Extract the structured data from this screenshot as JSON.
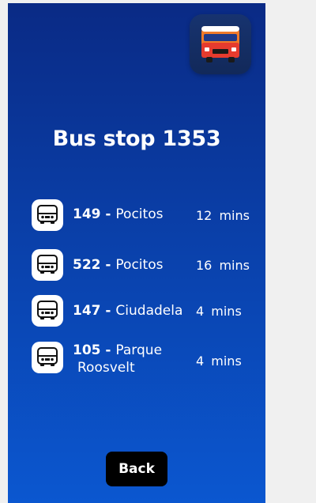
{
  "app_icon": "bus-app-icon",
  "title": "Bus stop 1353",
  "arrivals": [
    {
      "icon": "bus-icon",
      "route": "149",
      "separator": " - ",
      "destination": "Pocitos",
      "eta": "12 mins"
    },
    {
      "icon": "bus-icon",
      "route": "522",
      "separator": " - ",
      "destination": "Pocitos",
      "eta": "16 mins"
    },
    {
      "icon": "bus-icon",
      "route": "147",
      "separator": " - ",
      "destination": "Ciudadela",
      "eta": "4 mins"
    },
    {
      "icon": "bus-icon",
      "route": "105",
      "separator": " - ",
      "destination": "Parque",
      "destination_line2": "Roosvelt",
      "eta": "4 mins"
    }
  ],
  "back_label": "Back",
  "colors": {
    "background_top": "#0a2a85",
    "background_bottom": "#0b57d0",
    "text": "#ffffff",
    "button": "#000000",
    "bus_orange": "#f07a2a",
    "bus_red": "#e63b2e"
  }
}
